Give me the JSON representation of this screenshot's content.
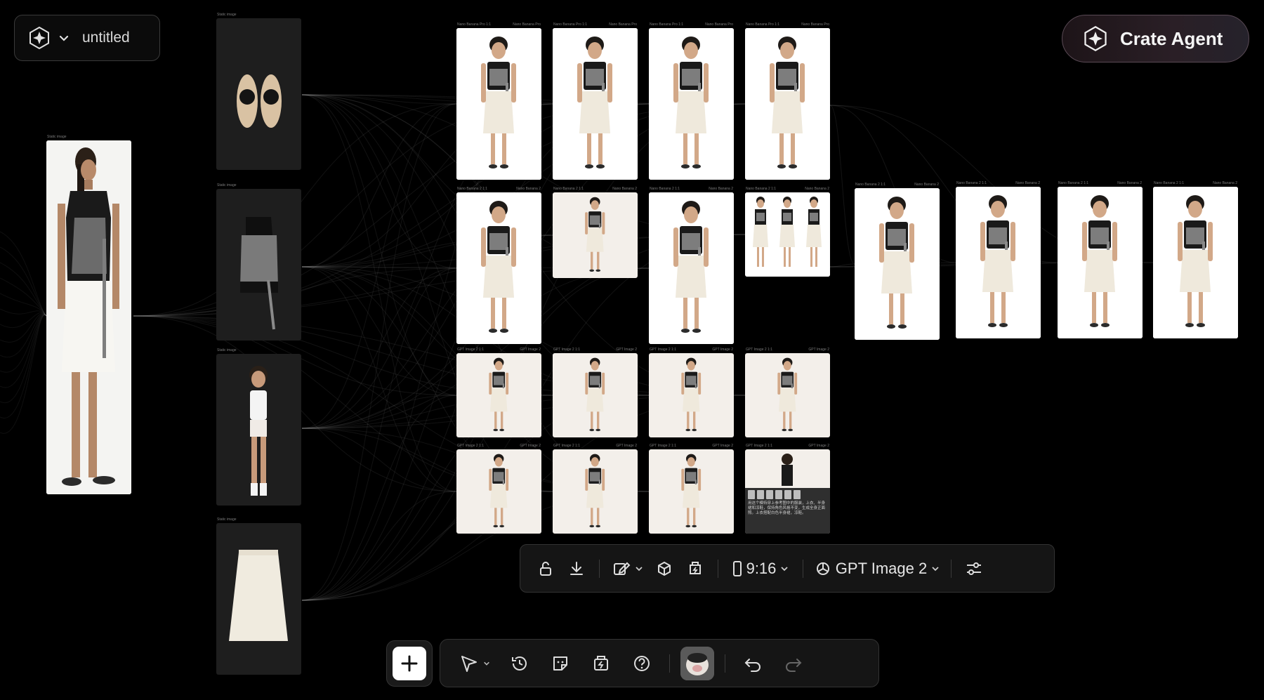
{
  "project": {
    "title": "untitled",
    "logo_icon": "sparkle-star-icon",
    "menu_icon": "chevron-down-icon"
  },
  "agent_button": {
    "label": "Crate Agent",
    "icon": "sparkle-star-icon"
  },
  "canvas": {
    "source_image": {
      "caption": "Static image"
    },
    "input_nodes": [
      {
        "caption": "Static image",
        "content": "sandals"
      },
      {
        "caption": "Static image",
        "content": "top"
      },
      {
        "caption": "Static image",
        "content": "character"
      },
      {
        "caption": "Static image",
        "content": "skirt"
      }
    ],
    "output_rows": [
      {
        "row": "nano-banana-pro",
        "caption": "Nano Banana Pro 1:1",
        "model": "Nano Banana Pro",
        "count": 4
      },
      {
        "row": "mixed",
        "caption": "Nano Banana 2 1:1",
        "model": "Nano Banana 2",
        "count": 4
      },
      {
        "row": "gpt-a",
        "caption": "GPT Image 2 1:1",
        "model": "GPT Image 2",
        "count": 4
      },
      {
        "row": "gpt-b",
        "caption": "GPT Image 2 1:1",
        "model": "GPT Image 2",
        "count": 4
      },
      {
        "row": "right-column",
        "caption": "Nano Banana 2 1:1",
        "model": "Nano Banana 2",
        "count": 4
      }
    ],
    "prompt_preview": "用这个模特穿上参考图中的服装，上衣、半身裙和凉鞋，保持角色风格不变，生成全身正面照。上衣搭配白色半身裙，凉鞋。"
  },
  "node_toolbar": {
    "unlock_icon": "unlock-icon",
    "download_icon": "download-icon",
    "edit_icon": "edit-image-icon",
    "cube_icon": "3d-cube-icon",
    "replace_icon": "upscale-icon",
    "aspect_ratio": "9:16",
    "model_name": "GPT Image 2",
    "settings_icon": "sliders-icon"
  },
  "bottom_dock": {
    "add_icon": "plus-icon",
    "select_icon": "cursor-arrow-icon",
    "history_icon": "history-icon",
    "sticker_icon": "sticker-icon",
    "quick_icon": "lightning-box-icon",
    "help_icon": "help-circle-icon",
    "undo_icon": "undo-icon",
    "redo_icon": "redo-icon"
  },
  "colors": {
    "background": "#000000",
    "panel": "#151515",
    "border": "#333333",
    "card_dark": "#1e1e1e"
  }
}
